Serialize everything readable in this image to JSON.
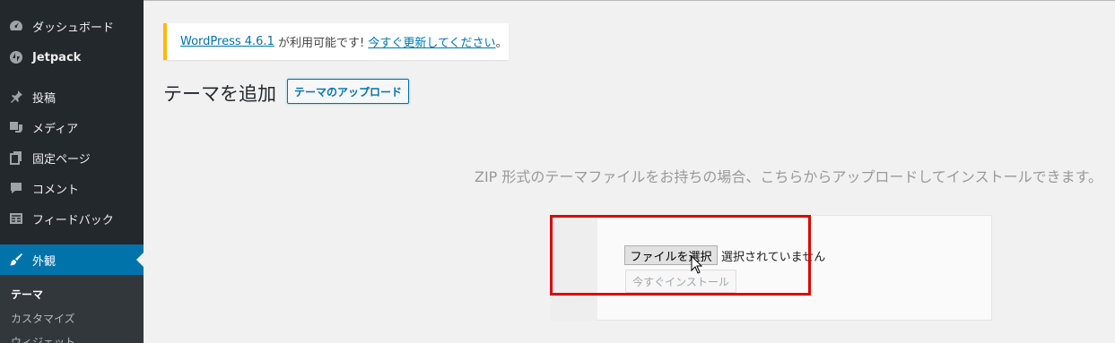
{
  "sidebar": {
    "items": [
      {
        "label": "ダッシュボード",
        "icon": "dashboard-icon"
      },
      {
        "label": "Jetpack",
        "icon": "jetpack-icon"
      },
      {
        "label": "投稿",
        "icon": "pin-icon"
      },
      {
        "label": "メディア",
        "icon": "media-icon"
      },
      {
        "label": "固定ページ",
        "icon": "page-icon"
      },
      {
        "label": "コメント",
        "icon": "comment-icon"
      },
      {
        "label": "フィードバック",
        "icon": "feedback-icon"
      },
      {
        "label": "外観",
        "icon": "brush-icon"
      }
    ],
    "submenu": [
      {
        "label": "テーマ"
      },
      {
        "label": "カスタマイズ"
      },
      {
        "label": "ウィジェット"
      }
    ],
    "colors": {
      "bg": "#23282d",
      "current": "#0073aa",
      "submenu_bg": "#32373c"
    }
  },
  "notice": {
    "link1": "WordPress 4.6.1",
    "text": " が利用可能です! ",
    "link2": "今すぐ更新してください",
    "end": "。",
    "accent": "#ffb900"
  },
  "page": {
    "title": "テーマを追加",
    "upload_button": "テーマのアップロード",
    "help_text": "ZIP 形式のテーマファイルをお持ちの場合、こちらからアップロードしてインストールできます。"
  },
  "form": {
    "file_button": "ファイルを選択",
    "no_file_text": "選択されていません",
    "install_button": "今すぐインストール"
  },
  "annotation": {
    "color": "#e00000"
  }
}
